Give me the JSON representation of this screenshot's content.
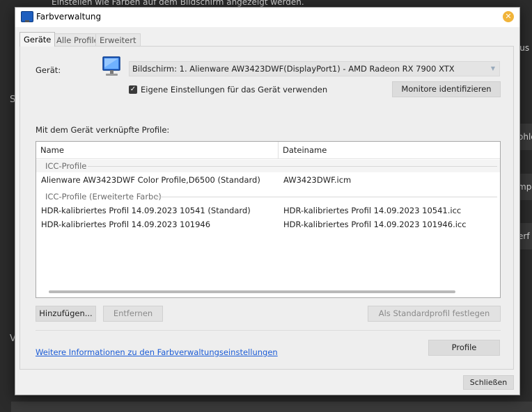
{
  "background": {
    "top_text": "Einstellen wie Farben auf dem Bildschirm angezeigt werden.",
    "right_fragments": [
      "Aus",
      "ohle",
      "mp",
      "erf"
    ],
    "left_letters": [
      "S",
      "V"
    ]
  },
  "window": {
    "title": "Farbverwaltung",
    "close_icon": "close-icon"
  },
  "tabs": [
    {
      "label": "Geräte",
      "active": true
    },
    {
      "label": "Alle Profile",
      "active": false
    },
    {
      "label": "Erweitert",
      "active": false
    }
  ],
  "device": {
    "label": "Gerät:",
    "selected": "Bildschirm: 1. Alienware AW3423DWF(DisplayPort1) - AMD Radeon RX 7900 XTX",
    "checkbox_label": "Eigene Einstellungen für das Gerät verwenden",
    "checkbox_checked": true,
    "identify_button": "Monitore identifizieren"
  },
  "profiles": {
    "section_label": "Mit dem Gerät verknüpfte Profile:",
    "columns": [
      "Name",
      "Dateiname"
    ],
    "groups": [
      {
        "title": "ICC-Profile",
        "rows": [
          {
            "name": "Alienware AW3423DWF Color Profile,D6500 (Standard)",
            "file": "AW3423DWF.icm"
          }
        ]
      },
      {
        "title": "ICC-Profile (Erweiterte Farbe)",
        "rows": [
          {
            "name": "HDR-kalibriertes Profil 14.09.2023 10541 (Standard)",
            "file": "HDR-kalibriertes Profil 14.09.2023 10541.icc"
          },
          {
            "name": "HDR-kalibriertes Profil 14.09.2023 101946",
            "file": "HDR-kalibriertes Profil 14.09.2023 101946.icc"
          }
        ]
      }
    ]
  },
  "buttons": {
    "add": "Hinzufügen...",
    "remove": "Entfernen",
    "set_default": "Als Standardprofil festlegen",
    "profile": "Profile",
    "close": "Schließen"
  },
  "link": "Weitere Informationen zu den Farbverwaltungseinstellungen"
}
